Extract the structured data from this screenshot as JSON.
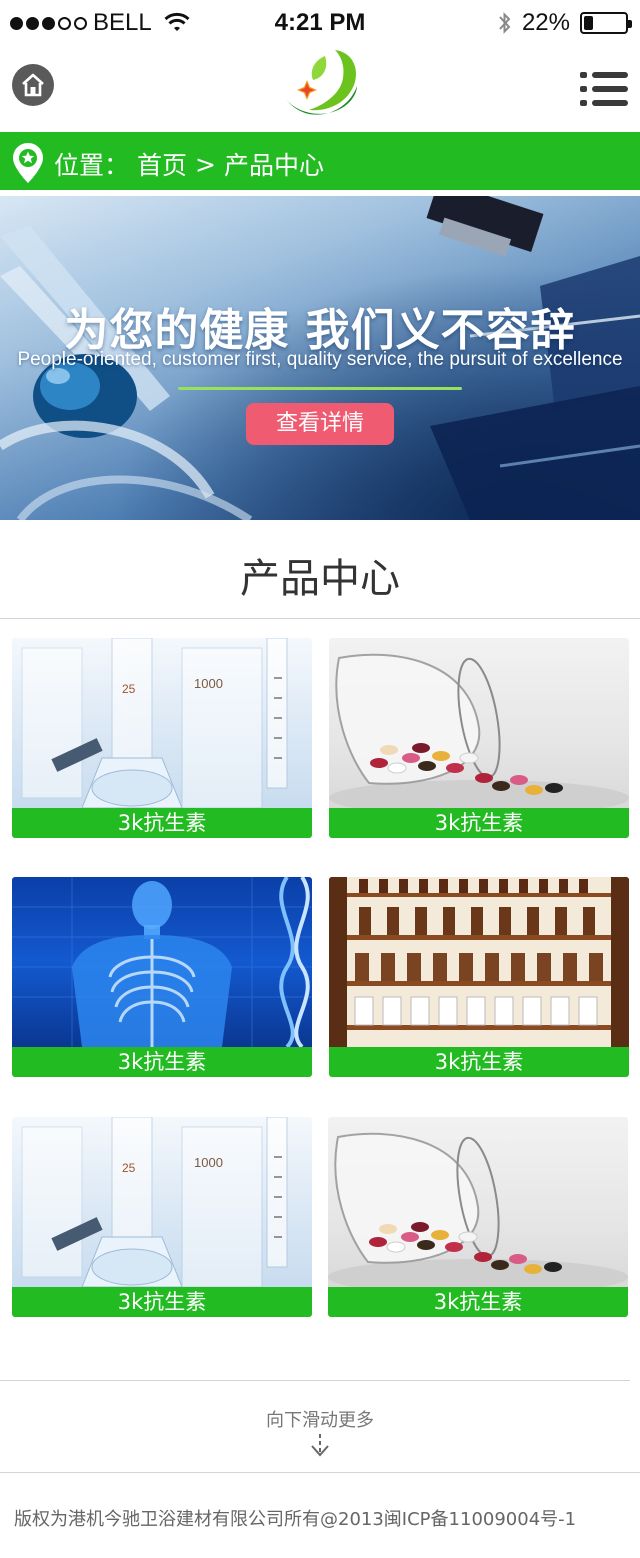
{
  "status_bar": {
    "carrier": "BELL",
    "time": "4:21 PM",
    "battery": "22%",
    "battery_level": 0.22,
    "signal_bars": 3,
    "signal_total": 5,
    "icons": [
      "wifi-icon",
      "bluetooth-icon",
      "battery-icon"
    ]
  },
  "header": {
    "icons": [
      "home-icon",
      "logo",
      "menu-icon"
    ]
  },
  "breadcrumb": {
    "prefix": "位置：",
    "home": "首页",
    "separator": ">",
    "current": "产品中心",
    "icon": "location-pin-icon"
  },
  "banner": {
    "title": "为您的健康  我们义不容辞",
    "subtitle": "People-oriented, customer first, quality service, the pursuit of excellence",
    "button_label": "查看详情"
  },
  "section": {
    "title": "产品中心"
  },
  "products": [
    {
      "label": "3k抗生素",
      "image": "lab-glassware"
    },
    {
      "label": "3k抗生素",
      "image": "pills-in-glass"
    },
    {
      "label": "3k抗生素",
      "image": "xray-body"
    },
    {
      "label": "3k抗生素",
      "image": "medicine-shelf"
    },
    {
      "label": "3k抗生素",
      "image": "lab-glassware"
    },
    {
      "label": "3k抗生素",
      "image": "pills-in-glass"
    }
  ],
  "more": {
    "label": "向下滑动更多",
    "icon": "arrow-down-icon"
  },
  "footer": {
    "copyright": "版权为港机今驰卫浴建材有限公司所有@2013闽ICP备11009004号-1"
  },
  "colors": {
    "brand_green": "#22bb22",
    "button_pink": "#ef5b70",
    "accent_line": "#9be05a"
  }
}
